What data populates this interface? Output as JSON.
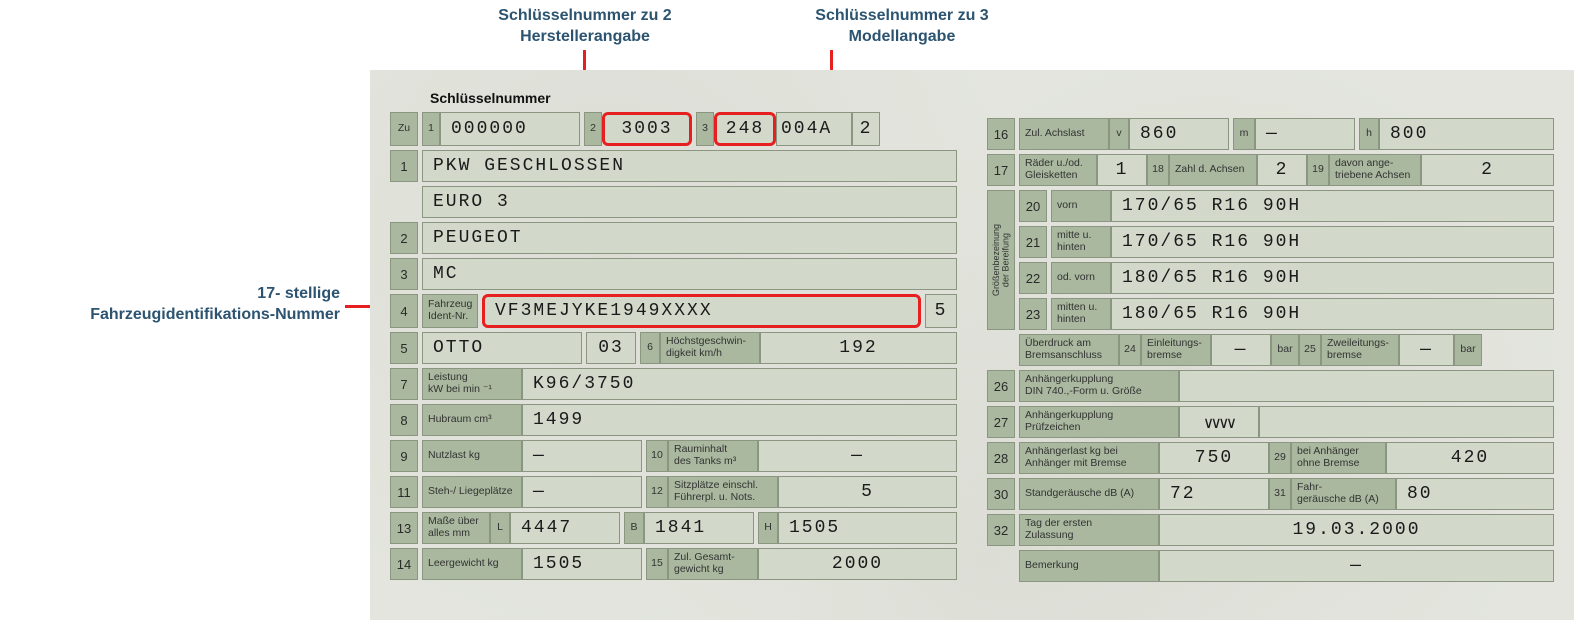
{
  "annotations": {
    "ann2_line1": "Schlüsselnummer zu 2",
    "ann2_line2": "Herstellerangabe",
    "ann3_line1": "Schlüsselnummer zu 3",
    "ann3_line2": "Modellangabe",
    "vin_line1": "17- stellige",
    "vin_line2": "Fahrzeugidentifikations-Nummer"
  },
  "header": {
    "title": "Schlüsselnummer",
    "zu": "Zu",
    "n1": "1",
    "v1": "000000",
    "n2": "2",
    "v2": "3003",
    "n3": "3",
    "v3": "248",
    "v3b": "004A",
    "v3c": "2"
  },
  "left": {
    "r1": {
      "n": "1",
      "v": "PKW GESCHLOSSEN"
    },
    "r1b": {
      "v": "EURO 3"
    },
    "r2": {
      "n": "2",
      "v": "PEUGEOT"
    },
    "r3": {
      "n": "3",
      "v": "MC"
    },
    "r4": {
      "n": "4",
      "lbl": "Fahrzeug\nIdent-Nr.",
      "v": "VF3MEJYKE1949XXXX",
      "end": "5"
    },
    "r5": {
      "n": "5",
      "v": "OTTO",
      "v2": "03",
      "n6": "6",
      "lbl6": "Höchstgeschwin-\ndigkeit km/h",
      "v6": "192"
    },
    "r7": {
      "n": "7",
      "lbl": "Leistung\nkW bei min ⁻¹",
      "v": "K96/3750"
    },
    "r8": {
      "n": "8",
      "lbl": "Hubraum cm³",
      "v": "1499"
    },
    "r9": {
      "n": "9",
      "lbl": "Nutzlast kg",
      "v": "—",
      "n10": "10",
      "lbl10": "Rauminhalt\ndes Tanks m³",
      "v10": "—"
    },
    "r11": {
      "n": "11",
      "lbl": "Steh-/ Liegeplätze",
      "v": "—",
      "n12": "12",
      "lbl12": "Sitzplätze einschl.\nFührerpl. u. Nots.",
      "v12": "5"
    },
    "r13": {
      "n": "13",
      "lbl": "Maße über\nalles mm",
      "L": "L",
      "vL": "4447",
      "B": "B",
      "vB": "1841",
      "H": "H",
      "vH": "1505"
    },
    "r14": {
      "n": "14",
      "lbl": "Leergewicht kg",
      "v": "1505",
      "n15": "15",
      "lbl15": "Zul. Gesamt-\ngewicht kg",
      "v15": "2000"
    }
  },
  "right": {
    "r16": {
      "n": "16",
      "lbl": "Zul. Achslast",
      "v_l": "v",
      "v_v": "860",
      "m_l": "m",
      "m_v": "—",
      "h_l": "h",
      "h_v": "800"
    },
    "r17": {
      "n": "17",
      "lbl": "Räder u./od.\nGleisketten",
      "v": "1",
      "n18": "18",
      "lbl18": "Zahl d. Achsen",
      "v18": "2",
      "n19": "19",
      "lbl19": "davon ange-\ntriebene Achsen",
      "v19": "2"
    },
    "tire_group_label": "Größenbezeinung\nder Bereifung",
    "r20": {
      "n": "20",
      "lbl": "vorn",
      "v": "170/65 R16 90H"
    },
    "r21": {
      "n": "21",
      "lbl": "mitte u.\nhinten",
      "v": "170/65 R16 90H"
    },
    "r22": {
      "n": "22",
      "lbl": "od. vorn",
      "v": "180/65 R16 90H"
    },
    "r23": {
      "n": "23",
      "lbl": "mitten u.\nhinten",
      "v": "180/65 R16 90H"
    },
    "r24": {
      "lbl": "Überdruck am\nBremsanschluss",
      "n24": "24",
      "lbl24": "Einleitungs-\nbremse",
      "v24": "—",
      "u24": "bar",
      "n25": "25",
      "lbl25": "Zweileitungs-\nbremse",
      "v25": "—",
      "u25": "bar"
    },
    "r26": {
      "n": "26",
      "lbl": "Anhängerkupplung\nDIN 740.,-Form u. Größe",
      "v": ""
    },
    "r27": {
      "n": "27",
      "lbl": "Anhängerkupplung\nPrüfzeichen",
      "zig": "∨∨∨∨",
      "v": ""
    },
    "r28": {
      "n": "28",
      "lbl": "Anhängerlast kg bei\nAnhänger mit Bremse",
      "v": "750",
      "n29": "29",
      "lbl29": "bei Anhänger\nohne Bremse",
      "v29": "420"
    },
    "r30": {
      "n": "30",
      "lbl": "Standgeräusche dB (A)",
      "v": "72",
      "n31": "31",
      "lbl31": "Fahr-\ngeräusche dB (A)",
      "v31": "80"
    },
    "r32": {
      "n": "32",
      "lbl": "Tag der ersten\nZulassung",
      "v": "19.03.2000"
    },
    "rB": {
      "lbl": "Bemerkung",
      "v": "—"
    }
  }
}
